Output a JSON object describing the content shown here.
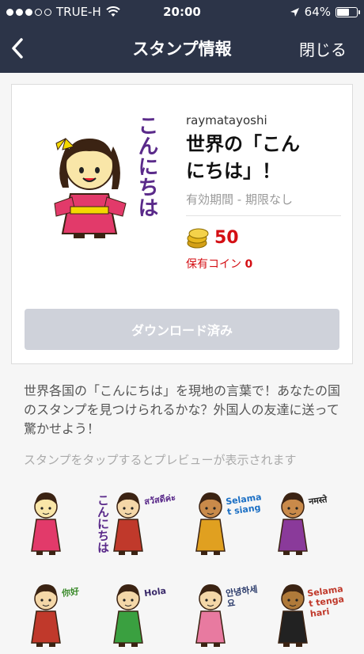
{
  "status_bar": {
    "carrier": "TRUE-H",
    "time": "20:00",
    "battery": "64%",
    "battery_fraction": 0.64
  },
  "nav": {
    "title": "スタンプ情報",
    "close_label": "閉じる"
  },
  "sticker_set": {
    "main_image_caption": "こんにちは",
    "author": "raymatayoshi",
    "name_line1": "世界の「こん",
    "name_line2": "にちは」！",
    "validity": "有効期間 - 期限なし",
    "price": "50",
    "owned_coins_label": "保有コイン",
    "owned_coins_value": "0",
    "download_label": "ダウンロード済み"
  },
  "description": "世界各国の「こんにちは」を現地の言葉で！あなたの国のスタンプを見つけられるかな？外国人の友達に送って驚かせよう！",
  "preview_hint": "スタンプをタップするとプレビューが表示されます",
  "stickers": [
    {
      "greeting": "こんにちは",
      "color": "#5a2a8a"
    },
    {
      "greeting": "สวัสดีค่ะ",
      "color": "#5a2a8a"
    },
    {
      "greeting": "Selamat siang",
      "color": "#1b6fc4"
    },
    {
      "greeting": "नमस्ते",
      "color": "#222222"
    },
    {
      "greeting": "你好",
      "color": "#3a8a2a"
    },
    {
      "greeting": "Hola",
      "color": "#3a2a6a"
    },
    {
      "greeting": "안녕하세요",
      "color": "#2a3a6a"
    },
    {
      "greeting": "Selamat tengahari",
      "color": "#c0392b"
    }
  ],
  "colors": {
    "nav_bg": "#2c3448",
    "price": "#d40f14",
    "button_disabled": "#cfd2da"
  }
}
